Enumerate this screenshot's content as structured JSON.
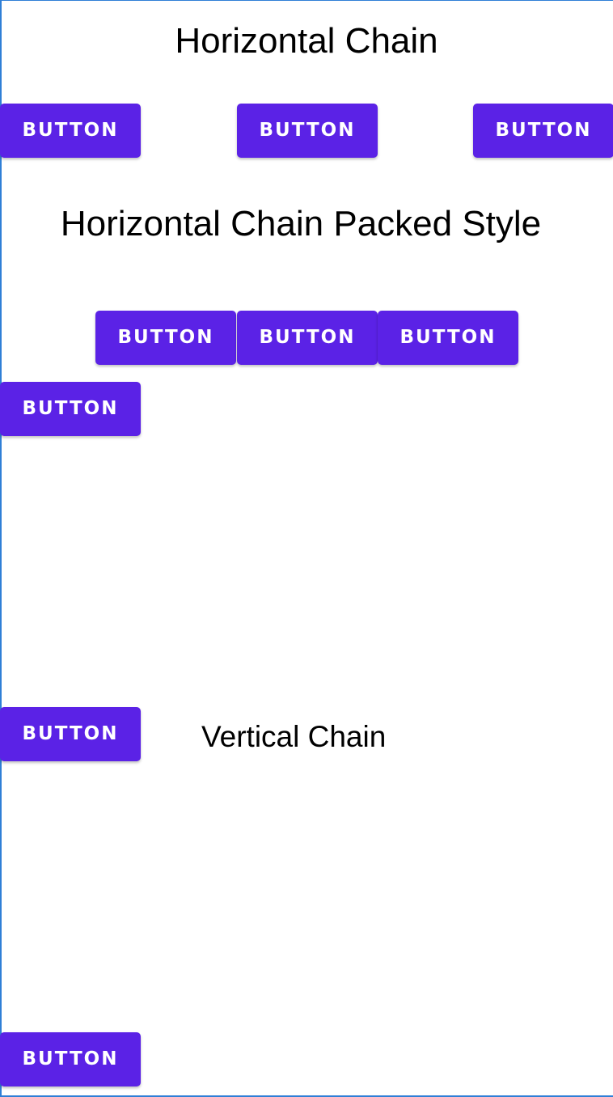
{
  "horizontal_chain": {
    "title": "Horizontal Chain",
    "buttons": [
      "BUTTON",
      "BUTTON",
      "BUTTON"
    ]
  },
  "horizontal_chain_packed": {
    "title": "Horizontal Chain Packed Style",
    "buttons": [
      "BUTTON",
      "BUTTON",
      "BUTTON"
    ]
  },
  "vertical_chain": {
    "title": "Vertical Chain",
    "buttons": [
      "BUTTON",
      "BUTTON",
      "BUTTON"
    ]
  },
  "colors": {
    "button_background": "#5b22e6",
    "button_text": "#ffffff",
    "page_background": "#ffffff",
    "frame_border": "#2f7fd6"
  }
}
